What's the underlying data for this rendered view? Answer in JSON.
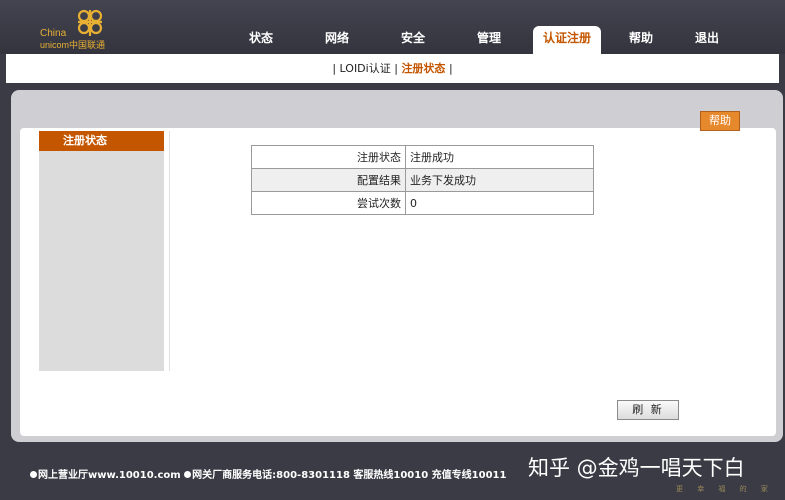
{
  "logo": {
    "line1": "China",
    "line2": "unicom中国联通"
  },
  "nav": [
    {
      "label": "状态"
    },
    {
      "label": "网络"
    },
    {
      "label": "安全"
    },
    {
      "label": "管理"
    },
    {
      "label": "认证注册",
      "active": true
    },
    {
      "label": "帮助"
    },
    {
      "label": "退出"
    }
  ],
  "subnav": {
    "sep": "|",
    "item1": "LOIDi认证",
    "item2": "注册状态"
  },
  "help_button": "帮助",
  "sidebar": {
    "title": "注册状态"
  },
  "table": [
    {
      "key": "注册状态",
      "value": "注册成功"
    },
    {
      "key": "配置结果",
      "value": "业务下发成功"
    },
    {
      "key": "尝试次数",
      "value": "0"
    }
  ],
  "refresh_button": "刷 新",
  "footer": {
    "item1": "网上营业厅www.10010.com",
    "item2": "网关厂商服务电话:800-8301118 客服热线10010 充值专线10011"
  },
  "watermark": {
    "text": "知乎 @金鸡一唱天下白",
    "sub": "更 幸 福 的 家"
  },
  "colors": {
    "accent": "#c45600",
    "header_bg": "#3b3b45",
    "help_btn": "#e6892c"
  }
}
